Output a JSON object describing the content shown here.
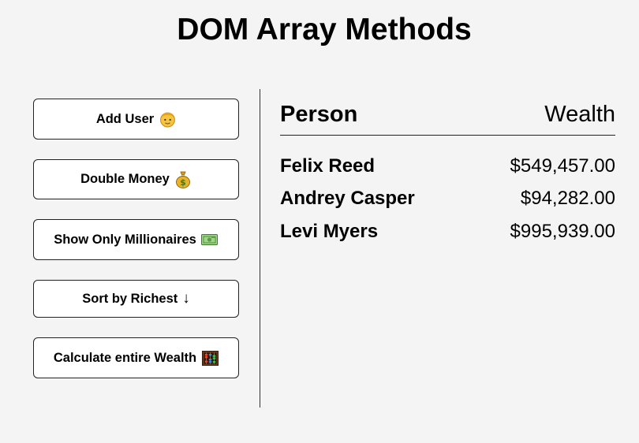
{
  "page": {
    "title": "DOM Array Methods"
  },
  "sidebar": {
    "buttons": [
      {
        "label": "Add User",
        "icon": "person-icon"
      },
      {
        "label": "Double Money",
        "icon": "money-bag-icon"
      },
      {
        "label": "Show Only Millionaires",
        "icon": "banknote-icon"
      },
      {
        "label": "Sort by Richest",
        "icon": "arrow-down-icon",
        "glyph": "↓"
      },
      {
        "label": "Calculate entire Wealth",
        "icon": "abacus-icon"
      }
    ]
  },
  "table": {
    "headers": {
      "person": "Person",
      "wealth": "Wealth"
    },
    "rows": [
      {
        "name": "Felix Reed",
        "wealth": "$549,457.00"
      },
      {
        "name": "Andrey Casper",
        "wealth": "$94,282.00"
      },
      {
        "name": "Levi Myers",
        "wealth": "$995,939.00"
      }
    ]
  }
}
